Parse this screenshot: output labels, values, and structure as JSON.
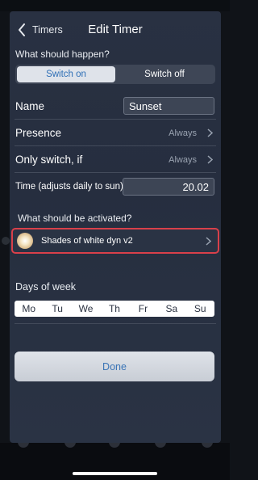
{
  "nav": {
    "back_label": "Timers",
    "title": "Edit Timer"
  },
  "what_should_happen": {
    "label": "What should happen?",
    "options": [
      "Switch on",
      "Switch off"
    ],
    "selected": "Switch on"
  },
  "name_row": {
    "label": "Name",
    "value": "Sunset"
  },
  "presence_row": {
    "label": "Presence",
    "value": "Always"
  },
  "only_switch_row": {
    "label": "Only switch, if",
    "value": "Always"
  },
  "time_row": {
    "label": "Time (adjusts daily to sun)",
    "value": "20.02"
  },
  "activation": {
    "label": "What should be activated?",
    "scene_name": "Shades of white dyn v2",
    "icon": "scene-thumbnail-icon"
  },
  "days_of_week": {
    "label": "Days of week",
    "days": [
      "Mo",
      "Tu",
      "We",
      "Th",
      "Fr",
      "Sa",
      "Su"
    ]
  },
  "done_label": "Done",
  "colors": {
    "accent": "#2e6fb6",
    "highlight_border": "#d9404a",
    "background": "#293142"
  }
}
